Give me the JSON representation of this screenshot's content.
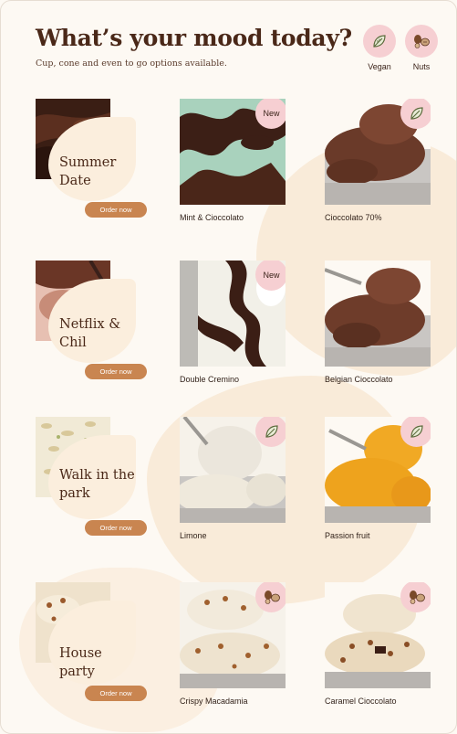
{
  "header": {
    "title": "What’s your mood today?",
    "subtitle": "Cup, cone and even to go options available."
  },
  "filters": [
    {
      "label": "Vegan",
      "icon": "leaf-icon"
    },
    {
      "label": "Nuts",
      "icon": "nuts-icon"
    }
  ],
  "moods": [
    {
      "name": "Summer Date",
      "button": "Order now"
    },
    {
      "name": "Netflix & Chil",
      "button": "Order now"
    },
    {
      "name": "Walk in the park",
      "button": "Order now"
    },
    {
      "name": "House party",
      "button": "Order now"
    }
  ],
  "products": [
    {
      "name": "Mint & Cioccolato",
      "badge": "New"
    },
    {
      "name": "Cioccolato 70%",
      "badge_icon": "leaf-icon"
    },
    {
      "name": "Double Cremino",
      "badge": "New"
    },
    {
      "name": "Belgian Cioccolato"
    },
    {
      "name": "Limone",
      "badge_icon": "leaf-icon"
    },
    {
      "name": "Passion fruit",
      "badge_icon": "leaf-icon"
    },
    {
      "name": "Crispy Macadamia",
      "badge_icon": "nuts-icon"
    },
    {
      "name": "Caramel Cioccolato",
      "badge_icon": "nuts-icon"
    }
  ],
  "colors": {
    "background": "#fdf9f3",
    "accent_button": "#c98550",
    "badge_pink": "#f6cfd2",
    "heading": "#4a2818"
  }
}
